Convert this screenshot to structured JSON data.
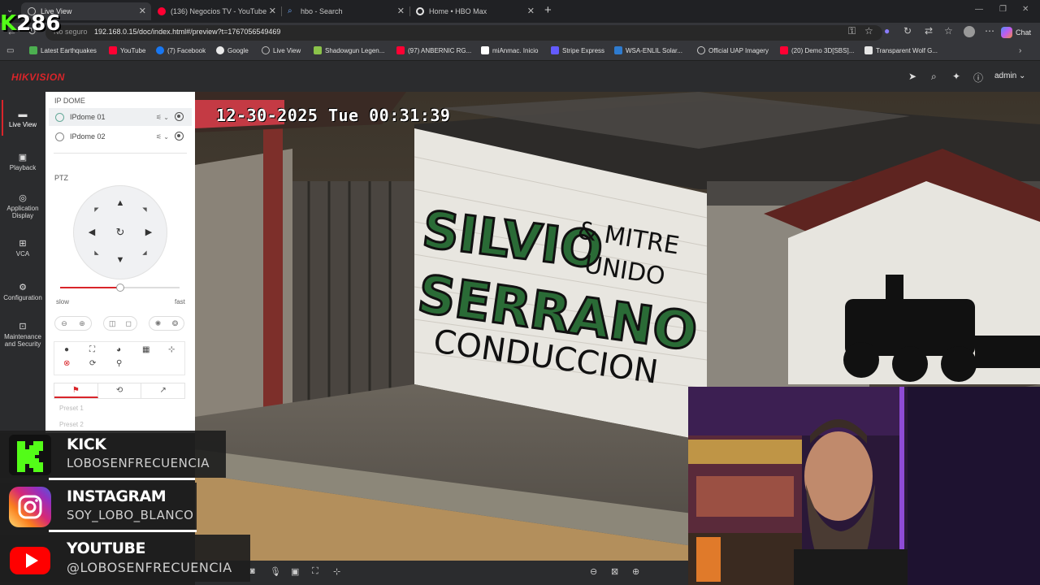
{
  "browser": {
    "tabs": [
      {
        "label": "Live View",
        "active": true,
        "favicon_color": "#c8c8c8"
      },
      {
        "label": "(136) Negocios TV - YouTube",
        "active": false,
        "favicon_color": "#ff0033"
      },
      {
        "label": "hbo - Search",
        "active": false,
        "favicon_color": "#6ea8fe"
      },
      {
        "label": "Home • HBO Max",
        "active": false,
        "favicon_color": "#e6e6e6"
      }
    ],
    "new_tab": "+",
    "url_security": "No seguro",
    "url": "192.168.0.15/doc/index.html#/preview?t=1767056549469",
    "chat_label": "Chat",
    "bookmarks": [
      {
        "label": "Latest Earthquakes",
        "color": "#4caf50"
      },
      {
        "label": "YouTube",
        "color": "#ff0033"
      },
      {
        "label": "(7) Facebook",
        "color": "#1877f2"
      },
      {
        "label": "Google",
        "color": "#eaeaea"
      },
      {
        "label": "Live View",
        "color": "#bbbbbb"
      },
      {
        "label": "Shadowgun Legen...",
        "color": "#8bc34a"
      },
      {
        "label": "(97) ANBERNIC RG...",
        "color": "#ff0033"
      },
      {
        "label": "miAnmac. Inicio",
        "color": "#ffffff"
      },
      {
        "label": "Stripe Express",
        "color": "#635bff"
      },
      {
        "label": "WSA-ENLIL Solar...",
        "color": "#2e7bcf"
      },
      {
        "label": "Official UAP Imagery",
        "color": "#cccccc"
      },
      {
        "label": "(20) Demo 3D[SBS]...",
        "color": "#ff0033"
      },
      {
        "label": "Transparent Wolf G...",
        "color": "#e6e6e6"
      }
    ]
  },
  "app": {
    "brand": "HIKVISION",
    "user": "admin ⌄",
    "nav": [
      {
        "label": "Live View",
        "icon": "monitor-icon"
      },
      {
        "label": "Playback",
        "icon": "playback-icon"
      },
      {
        "label": "Application Display",
        "icon": "application-icon"
      },
      {
        "label": "VCA",
        "icon": "vca-icon"
      },
      {
        "label": "Configuration",
        "icon": "gear-icon"
      },
      {
        "label": "Maintenance and Security",
        "icon": "maintenance-icon"
      }
    ],
    "panel_title": "IP DOME",
    "cameras": [
      "IPdome 01",
      "IPdome 02"
    ],
    "ptz_label": "PTZ",
    "speed_slow": "slow",
    "speed_fast": "fast",
    "speed_level": 0.5,
    "presets": [
      "Preset 1",
      "Preset 2"
    ],
    "accent_color": "#d9252a"
  },
  "video": {
    "osd_timestamp": "12-30-2025 Tue 00:31:39",
    "wall_text": [
      "SILVIO",
      "& MITRE",
      "UNIDO",
      "SERRANO",
      "CONDUCCION"
    ]
  },
  "overlay": {
    "counter": "286",
    "social": [
      {
        "name": "KICK",
        "handle": "LOBOSENFRECUENCIA",
        "color": "#53fc18"
      },
      {
        "name": "INSTAGRAM",
        "handle": "SOY_LOBO_BLANCO",
        "color": "#d62976"
      },
      {
        "name": "YOUTUBE",
        "handle": "@LOBOSENFRECUENCIA",
        "color": "#ff0000"
      }
    ]
  }
}
